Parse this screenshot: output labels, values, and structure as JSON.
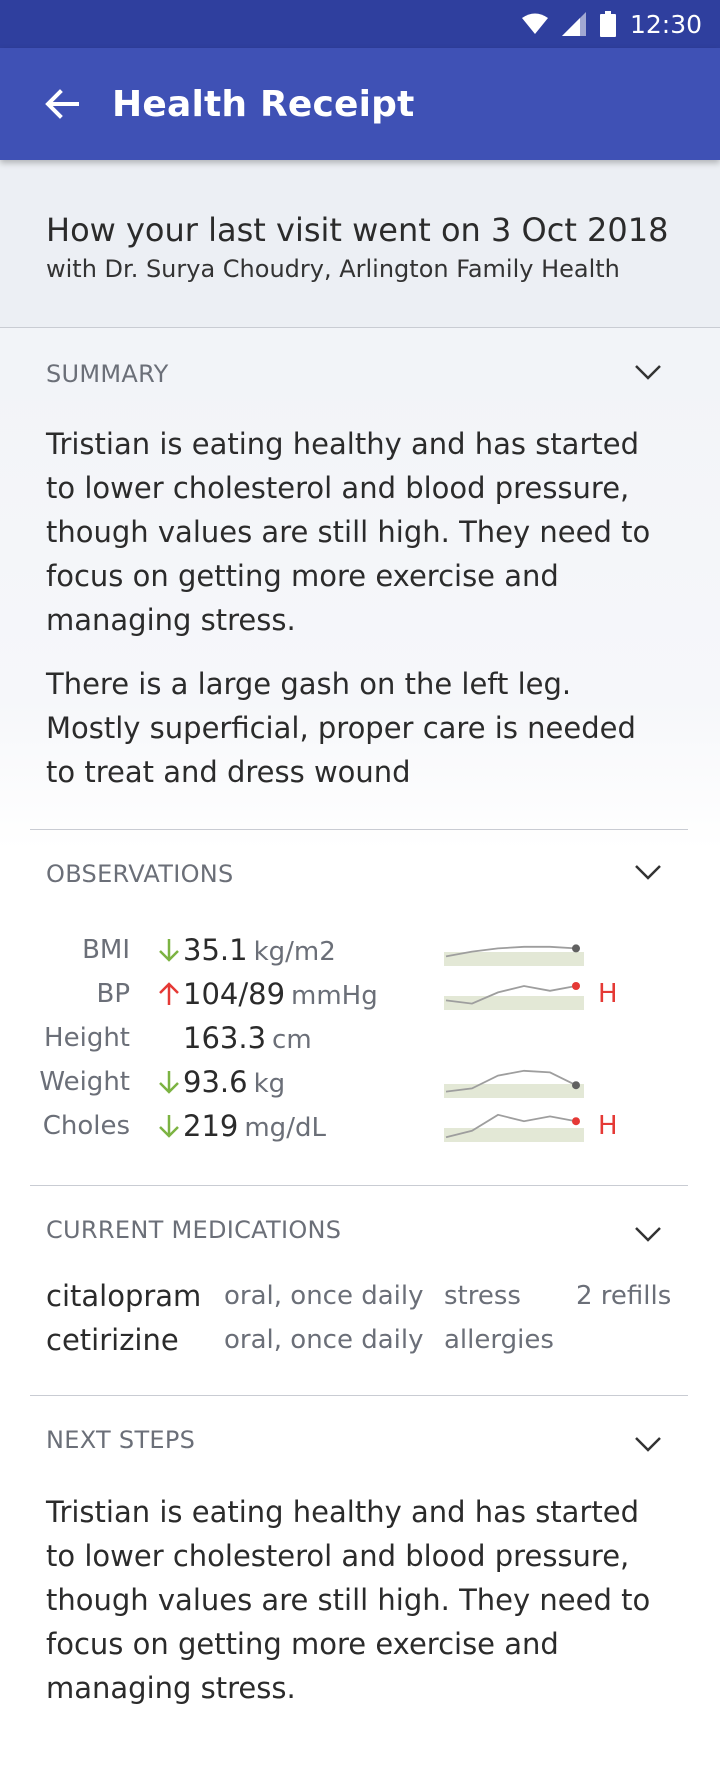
{
  "status_bar": {
    "time": "12:30"
  },
  "app_bar": {
    "title": "Health Receipt"
  },
  "visit": {
    "title": "How your last visit went on 3 Oct 2018",
    "subtitle": "with Dr. Surya Choudry, Arlington Family Health"
  },
  "summary": {
    "label": "SUMMARY",
    "paragraphs": [
      "Tristian is eating healthy and has started to lower cholesterol and blood pressure, though values are still high. They need to focus on getting more exercise and managing stress.",
      "There is a large gash on the left leg. Mostly superficial, proper care is needed to treat and dress wound"
    ]
  },
  "observations": {
    "label": "OBSERVATIONS",
    "rows": [
      {
        "label": "BMI",
        "trend": "down",
        "value": "35.1",
        "unit": "kg/m2",
        "flag": "",
        "spark": [
          0.3,
          0.45,
          0.55,
          0.6,
          0.6,
          0.55
        ],
        "point_color": "#616161"
      },
      {
        "label": "BP",
        "trend": "up",
        "value": "104/89",
        "unit": "mmHg",
        "flag": "H",
        "spark": [
          0.3,
          0.2,
          0.55,
          0.75,
          0.6,
          0.75
        ],
        "point_color": "#e53935"
      },
      {
        "label": "Height",
        "trend": "",
        "value": "163.3",
        "unit": "cm",
        "flag": "",
        "spark": [],
        "point_color": ""
      },
      {
        "label": "Weight",
        "trend": "down",
        "value": "93.6",
        "unit": "kg",
        "flag": "",
        "spark": [
          0.2,
          0.3,
          0.7,
          0.85,
          0.8,
          0.4
        ],
        "point_color": "#616161"
      },
      {
        "label": "Choles",
        "trend": "down",
        "value": "219",
        "unit": "mg/dL",
        "flag": "H",
        "spark": [
          0.15,
          0.35,
          0.85,
          0.65,
          0.8,
          0.65
        ],
        "point_color": "#e53935"
      }
    ],
    "colors": {
      "down": "#7cb342",
      "up": "#e53935",
      "band": "#e3e8d6",
      "line": "#9e9e9e"
    }
  },
  "medications": {
    "label": "CURRENT MEDICATIONS",
    "rows": [
      {
        "name": "citalopram",
        "route": "oral, once daily",
        "reason": "stress",
        "refills": "2 refills"
      },
      {
        "name": "cetirizine",
        "route": "oral, once daily",
        "reason": "allergies",
        "refills": ""
      }
    ]
  },
  "next_steps": {
    "label": "NEXT STEPS",
    "paragraph": "Tristian is eating healthy and has started to lower cholesterol and blood pressure, though values are still high. They need to focus on getting more exercise and managing stress."
  }
}
